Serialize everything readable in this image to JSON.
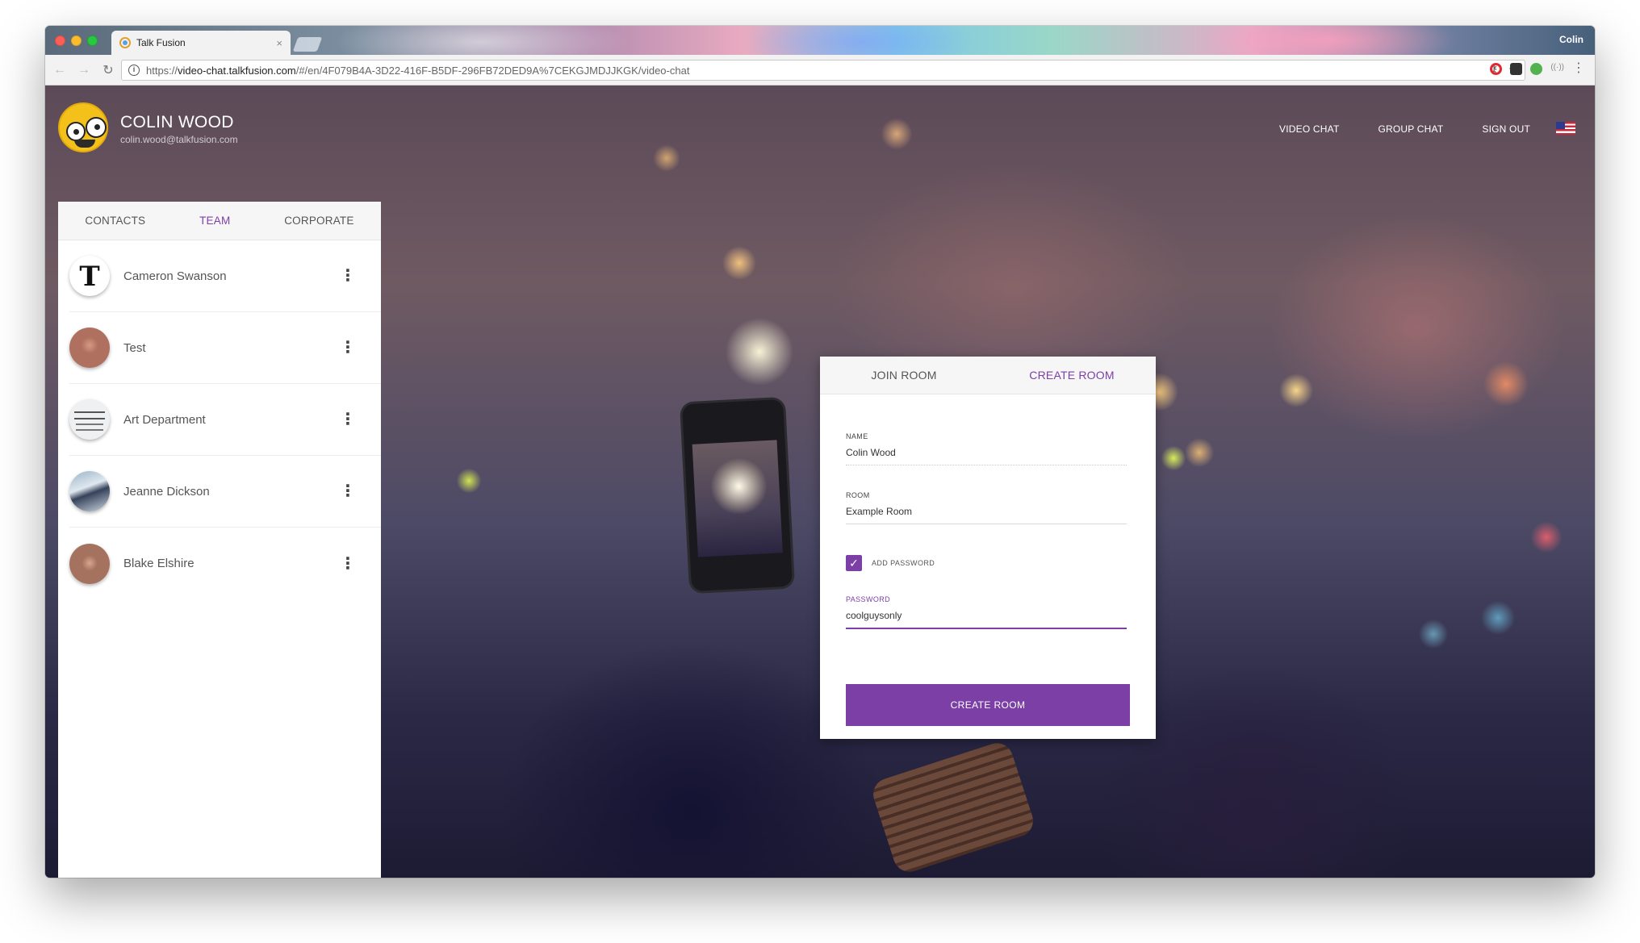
{
  "browser": {
    "tab_title": "Talk Fusion",
    "tab_close": "×",
    "profile_name": "Colin",
    "url_prefix": "https://",
    "url_host": "video-chat.talkfusion.com",
    "url_path": "/#/en/4F079B4A-3D22-416F-B5DF-296FB72DED9A%7CEKGJMDJJKGK/video-chat",
    "back_icon": "←",
    "forward_icon": "→",
    "reload_icon": "↻",
    "key_icon": "⚷",
    "star_icon": "☆",
    "menu_icon": "⋮",
    "cast_icon": "((·))"
  },
  "header": {
    "user_name": "COLIN WOOD",
    "user_email": "colin.wood@talkfusion.com",
    "nav": [
      "VIDEO CHAT",
      "GROUP CHAT",
      "SIGN OUT"
    ]
  },
  "sidebar": {
    "tabs": [
      {
        "label": "CONTACTS",
        "active": false
      },
      {
        "label": "TEAM",
        "active": true
      },
      {
        "label": "CORPORATE",
        "active": false
      }
    ],
    "contacts": [
      {
        "name": "Cameron Swanson",
        "avatar": "tesla-logo"
      },
      {
        "name": "Test",
        "avatar": "man-photo"
      },
      {
        "name": "Art Department",
        "avatar": "masks-drawing"
      },
      {
        "name": "Jeanne Dickson",
        "avatar": "bird-photo"
      },
      {
        "name": "Blake Elshire",
        "avatar": "man-photo"
      }
    ],
    "kebab": "⋮"
  },
  "dialog": {
    "tabs": [
      {
        "label": "JOIN ROOM",
        "active": false
      },
      {
        "label": "CREATE ROOM",
        "active": true
      }
    ],
    "name_label": "NAME",
    "name_value": "Colin Wood",
    "room_label": "ROOM",
    "room_value": "Example Room",
    "checkbox_checked": true,
    "checkmark": "✓",
    "checkbox_label": "ADD PASSWORD",
    "password_label": "PASSWORD",
    "password_value": "coolguysonly",
    "submit_label": "CREATE ROOM"
  },
  "colors": {
    "accent": "#7b3fa6",
    "sidebar_bg": "#ffffff",
    "tab_bar_bg": "#f6f6f6"
  }
}
